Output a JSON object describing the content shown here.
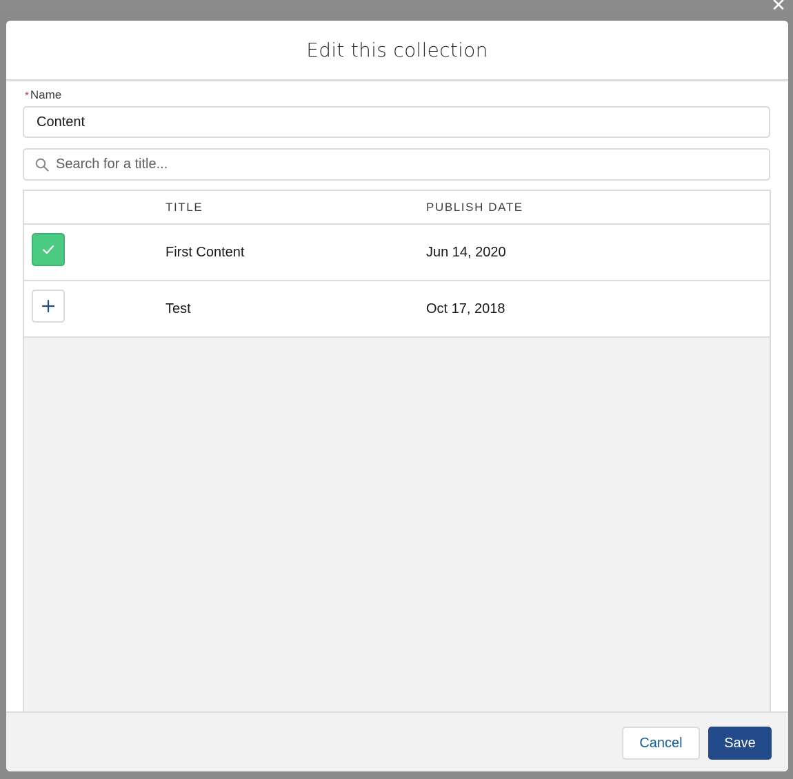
{
  "modal": {
    "title": "Edit this collection",
    "close_icon": "close-icon"
  },
  "form": {
    "name_label": "Name",
    "required_marker": "*",
    "name_value": "Content"
  },
  "search": {
    "placeholder": "Search for a title...",
    "icon": "search-icon"
  },
  "table": {
    "columns": [
      "TITLE",
      "PUBLISH DATE"
    ],
    "rows": [
      {
        "title": "First Content",
        "publish_date": "Jun 14, 2020",
        "selected": true,
        "action_icon": "check-icon"
      },
      {
        "title": "Test",
        "publish_date": "Oct 17, 2018",
        "selected": false,
        "action_icon": "plus-icon"
      }
    ]
  },
  "footer": {
    "cancel_label": "Cancel",
    "save_label": "Save"
  },
  "colors": {
    "selected_green": "#4bca81",
    "brand_blue": "#234a8a",
    "required_red": "#c23934",
    "link_blue": "#0b5fa5"
  }
}
